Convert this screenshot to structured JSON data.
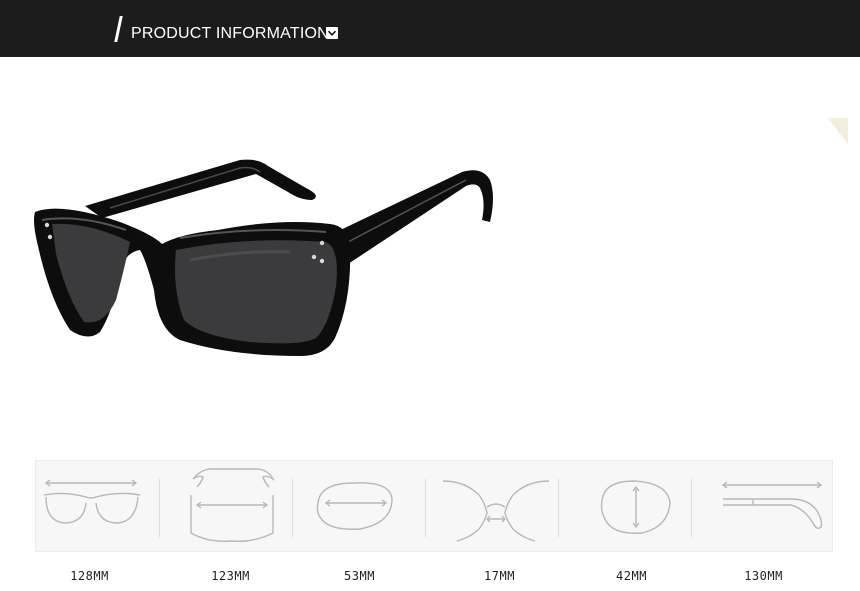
{
  "header": {
    "title": "PRODUCT INFORMATION",
    "badge_icon": "chevron-down-icon"
  },
  "colors": {
    "header_background": "#1c1c1c",
    "header_text": "#ffffff",
    "frame": "#0d0d0d",
    "lens": "#3b3b3d",
    "spec_icon_stroke": "#b8b8b8",
    "spec_panel_background": "#f7f7f7"
  },
  "product": {
    "image_subject": "black sunglasses"
  },
  "specs": [
    {
      "icon": "frame-width-icon",
      "value": "128MM"
    },
    {
      "icon": "head-width-icon",
      "value": "123MM"
    },
    {
      "icon": "lens-width-icon",
      "value": "53MM"
    },
    {
      "icon": "bridge-width-icon",
      "value": "17MM"
    },
    {
      "icon": "lens-height-icon",
      "value": "42MM"
    },
    {
      "icon": "temple-length-icon",
      "value": "130MM"
    }
  ]
}
